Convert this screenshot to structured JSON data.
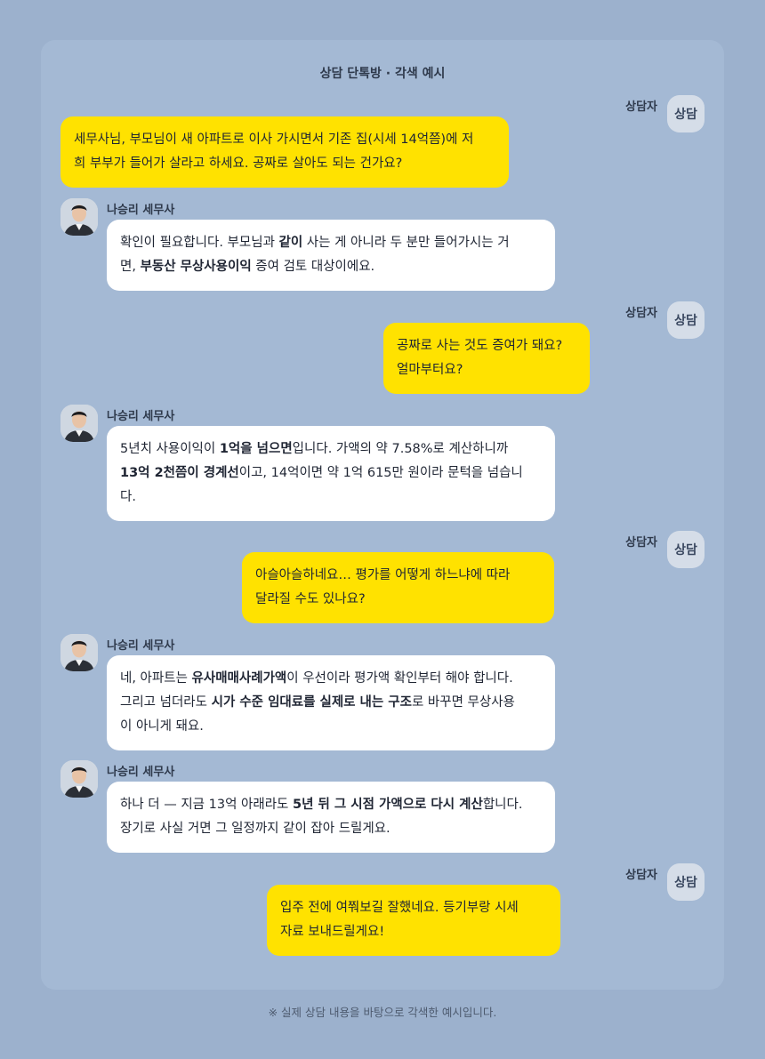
{
  "room_title": "상담 단톡방 · 각색 예시",
  "user_name": "상담자",
  "user_avatar_label": "상담",
  "pro_name": "나승리 세무사",
  "messages": [
    {
      "from": "user",
      "parts": [
        {
          "text": "세무사님, 부모님이 새 아파트로 이사 가시면서 기존 집(시세 14억쯤)에 저\n희 부부가 들어가 살라고 하세요. 공짜로 살아도 되는 건가요?"
        }
      ]
    },
    {
      "from": "pro",
      "parts": [
        {
          "text": "확인이 필요합니다. 부모님과 "
        },
        {
          "text": "같이",
          "bold": true
        },
        {
          "text": " 사는 게 아니라 두 분만 들어가시는 거\n면, "
        },
        {
          "text": "부동산 무상사용이익",
          "bold": true
        },
        {
          "text": " 증여 검토 대상이에요."
        }
      ]
    },
    {
      "from": "user",
      "parts": [
        {
          "text": "공짜로 사는 것도 증여가 돼요?\n얼마부터요?"
        }
      ]
    },
    {
      "from": "pro",
      "parts": [
        {
          "text": "5년치 사용이익이 "
        },
        {
          "text": "1억을 넘으면",
          "bold": true
        },
        {
          "text": "입니다. 가액의 약 7.58%로 계산하니까\n"
        },
        {
          "text": "13억 2천쯤이 경계선",
          "bold": true
        },
        {
          "text": "이고, 14억이면 약 1억 615만 원이라 문턱을 넘습니\n다."
        }
      ]
    },
    {
      "from": "user",
      "parts": [
        {
          "text": "아슬아슬하네요… 평가를 어떻게 하느냐에 따라\n달라질 수도 있나요?"
        }
      ]
    },
    {
      "from": "pro",
      "parts": [
        {
          "text": "네, 아파트는 "
        },
        {
          "text": "유사매매사례가액",
          "bold": true
        },
        {
          "text": "이 우선이라 평가액 확인부터 해야 합니다.\n그리고 넘더라도 "
        },
        {
          "text": "시가 수준 임대료를 실제로 내는 구조",
          "bold": true
        },
        {
          "text": "로 바꾸면 무상사용\n이 아니게 돼요."
        }
      ]
    },
    {
      "from": "pro",
      "parts": [
        {
          "text": "하나 더 — 지금 13억 아래라도 "
        },
        {
          "text": "5년 뒤 그 시점 가액으로 다시 계산",
          "bold": true
        },
        {
          "text": "합니다.\n장기로 사실 거면 그 일정까지 같이 잡아 드릴게요."
        }
      ]
    },
    {
      "from": "user",
      "parts": [
        {
          "text": "입주 전에 여쭤보길 잘했네요. 등기부랑 시세\n자료 보내드릴게요!"
        }
      ]
    }
  ],
  "footnote": "※ 실제 상담 내용을 바탕으로 각색한 예시입니다."
}
